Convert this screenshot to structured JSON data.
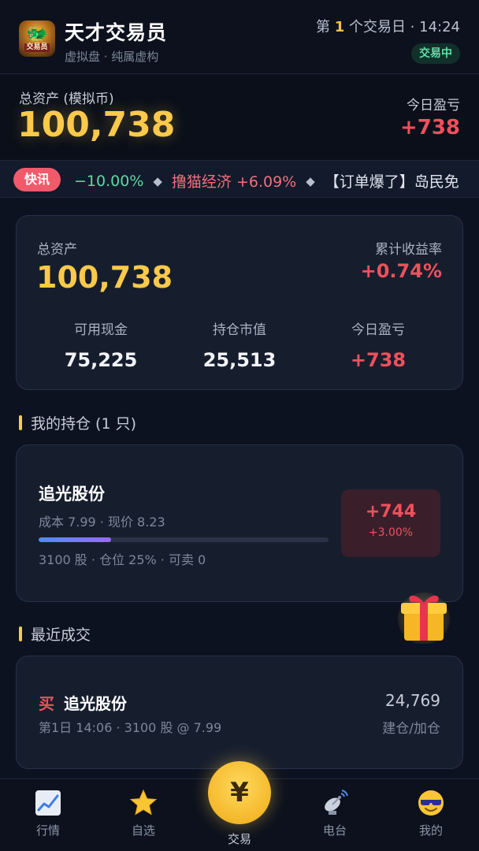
{
  "header": {
    "logo_text": "交易员",
    "title": "天才交易员",
    "subtitle": "虚拟盘 · 纯属虚构",
    "day_prefix": "第",
    "day_number": "1",
    "day_suffix": "个交易日 · 14:24",
    "status": "交易中"
  },
  "asset_header": {
    "label": "总资产 (模拟币)",
    "value": "100,738",
    "pl_label": "今日盈亏",
    "pl_value": "+738"
  },
  "ticker": {
    "badge": "快讯",
    "items": [
      {
        "text": "−10.00%",
        "tone": "green"
      },
      {
        "text": "撸猫经济 +6.09%",
        "tone": "red"
      },
      {
        "text": "【订单爆了】岛民免",
        "tone": "white"
      }
    ]
  },
  "summary": {
    "total_label": "总资产",
    "total_value": "100,738",
    "rate_label": "累计收益率",
    "rate_value": "+0.74%",
    "stats": [
      {
        "label": "可用现金",
        "value": "75,225"
      },
      {
        "label": "持仓市值",
        "value": "25,513"
      },
      {
        "label": "今日盈亏",
        "value": "+738"
      }
    ]
  },
  "holdings_section": {
    "title": "我的持仓 (1 只)"
  },
  "holding": {
    "name": "追光股份",
    "meta": "成本 7.99 · 现价 8.23",
    "position_fraction": 0.25,
    "meta2": "3100 股 · 仓位 25% · 可卖 0",
    "pl_amount": "+744",
    "pl_percent": "+3.00%"
  },
  "trades_section": {
    "title": "最近成交"
  },
  "trade": {
    "side": "买",
    "name": "追光股份",
    "meta": "第1日 14:06 · 3100 股 @ 7.99",
    "amount": "24,769",
    "action": "建仓/加仓"
  },
  "tabbar": {
    "tabs": [
      {
        "label": "行情",
        "icon": "chart-icon"
      },
      {
        "label": "自选",
        "icon": "star-icon"
      },
      {
        "label": "交易",
        "icon": "yen-icon",
        "symbol": "¥"
      },
      {
        "label": "电台",
        "icon": "satellite-dish-icon"
      },
      {
        "label": "我的",
        "icon": "cool-face-icon"
      }
    ]
  },
  "colors": {
    "gold": "#fcc94a",
    "up_red": "#f0505d",
    "down_green": "#5ed9a3",
    "background": "#0d1220"
  }
}
